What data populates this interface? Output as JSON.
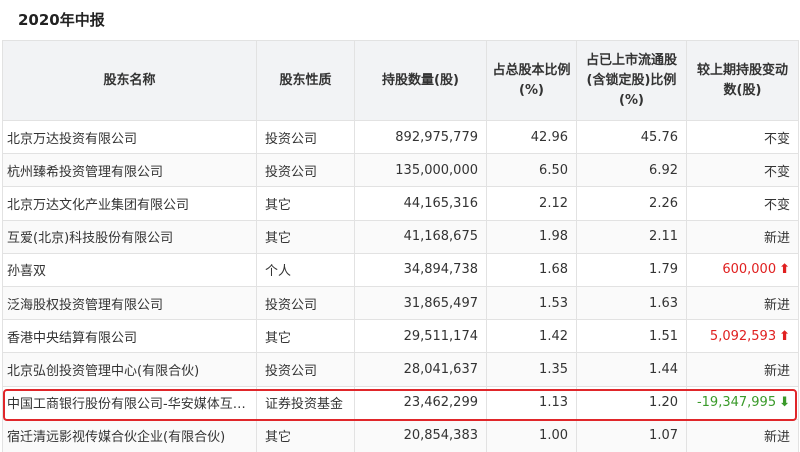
{
  "period_title": "2020年中报",
  "headers": {
    "name": "股东名称",
    "type": "股东性质",
    "shares": "持股数量(股)",
    "pct_total": "占总股本比例(%)",
    "pct_float": "占已上市流通股(含锁定股)比例(%)",
    "change": "较上期持股变动数(股)"
  },
  "rows": [
    {
      "name": "北京万达投资有限公司",
      "type": "投资公司",
      "shares": "892,975,779",
      "pct_total": "42.96",
      "pct_float": "45.76",
      "change": "不变",
      "trend": "none"
    },
    {
      "name": "杭州臻希投资管理有限公司",
      "type": "投资公司",
      "shares": "135,000,000",
      "pct_total": "6.50",
      "pct_float": "6.92",
      "change": "不变",
      "trend": "none"
    },
    {
      "name": "北京万达文化产业集团有限公司",
      "type": "其它",
      "shares": "44,165,316",
      "pct_total": "2.12",
      "pct_float": "2.26",
      "change": "不变",
      "trend": "none"
    },
    {
      "name": "互爱(北京)科技股份有限公司",
      "type": "其它",
      "shares": "41,168,675",
      "pct_total": "1.98",
      "pct_float": "2.11",
      "change": "新进",
      "trend": "none"
    },
    {
      "name": "孙喜双",
      "type": "个人",
      "shares": "34,894,738",
      "pct_total": "1.68",
      "pct_float": "1.79",
      "change": "600,000",
      "trend": "up"
    },
    {
      "name": "泛海股权投资管理有限公司",
      "type": "投资公司",
      "shares": "31,865,497",
      "pct_total": "1.53",
      "pct_float": "1.63",
      "change": "新进",
      "trend": "none"
    },
    {
      "name": "香港中央结算有限公司",
      "type": "其它",
      "shares": "29,511,174",
      "pct_total": "1.42",
      "pct_float": "1.51",
      "change": "5,092,593",
      "trend": "up"
    },
    {
      "name": "北京弘创投资管理中心(有限合伙)",
      "type": "投资公司",
      "shares": "28,041,637",
      "pct_total": "1.35",
      "pct_float": "1.44",
      "change": "新进",
      "trend": "none"
    },
    {
      "name": "中国工商银行股份有限公司-华安媒体互联网混合型证券投资基金",
      "type": "证券投资基金",
      "shares": "23,462,299",
      "pct_total": "1.13",
      "pct_float": "1.20",
      "change": "-19,347,995",
      "trend": "down"
    },
    {
      "name": "宿迁清远影视传媒合伙企业(有限合伙)",
      "type": "其它",
      "shares": "20,854,383",
      "pct_total": "1.00",
      "pct_float": "1.07",
      "change": "新进",
      "trend": "none"
    }
  ],
  "colors": {
    "up": "#e02020",
    "down": "#3a9a2a",
    "highlight": "#e0262a",
    "header_bg": "#f2f3f5"
  },
  "icons": {
    "up": "arrow-up-icon",
    "down": "arrow-down-icon"
  }
}
